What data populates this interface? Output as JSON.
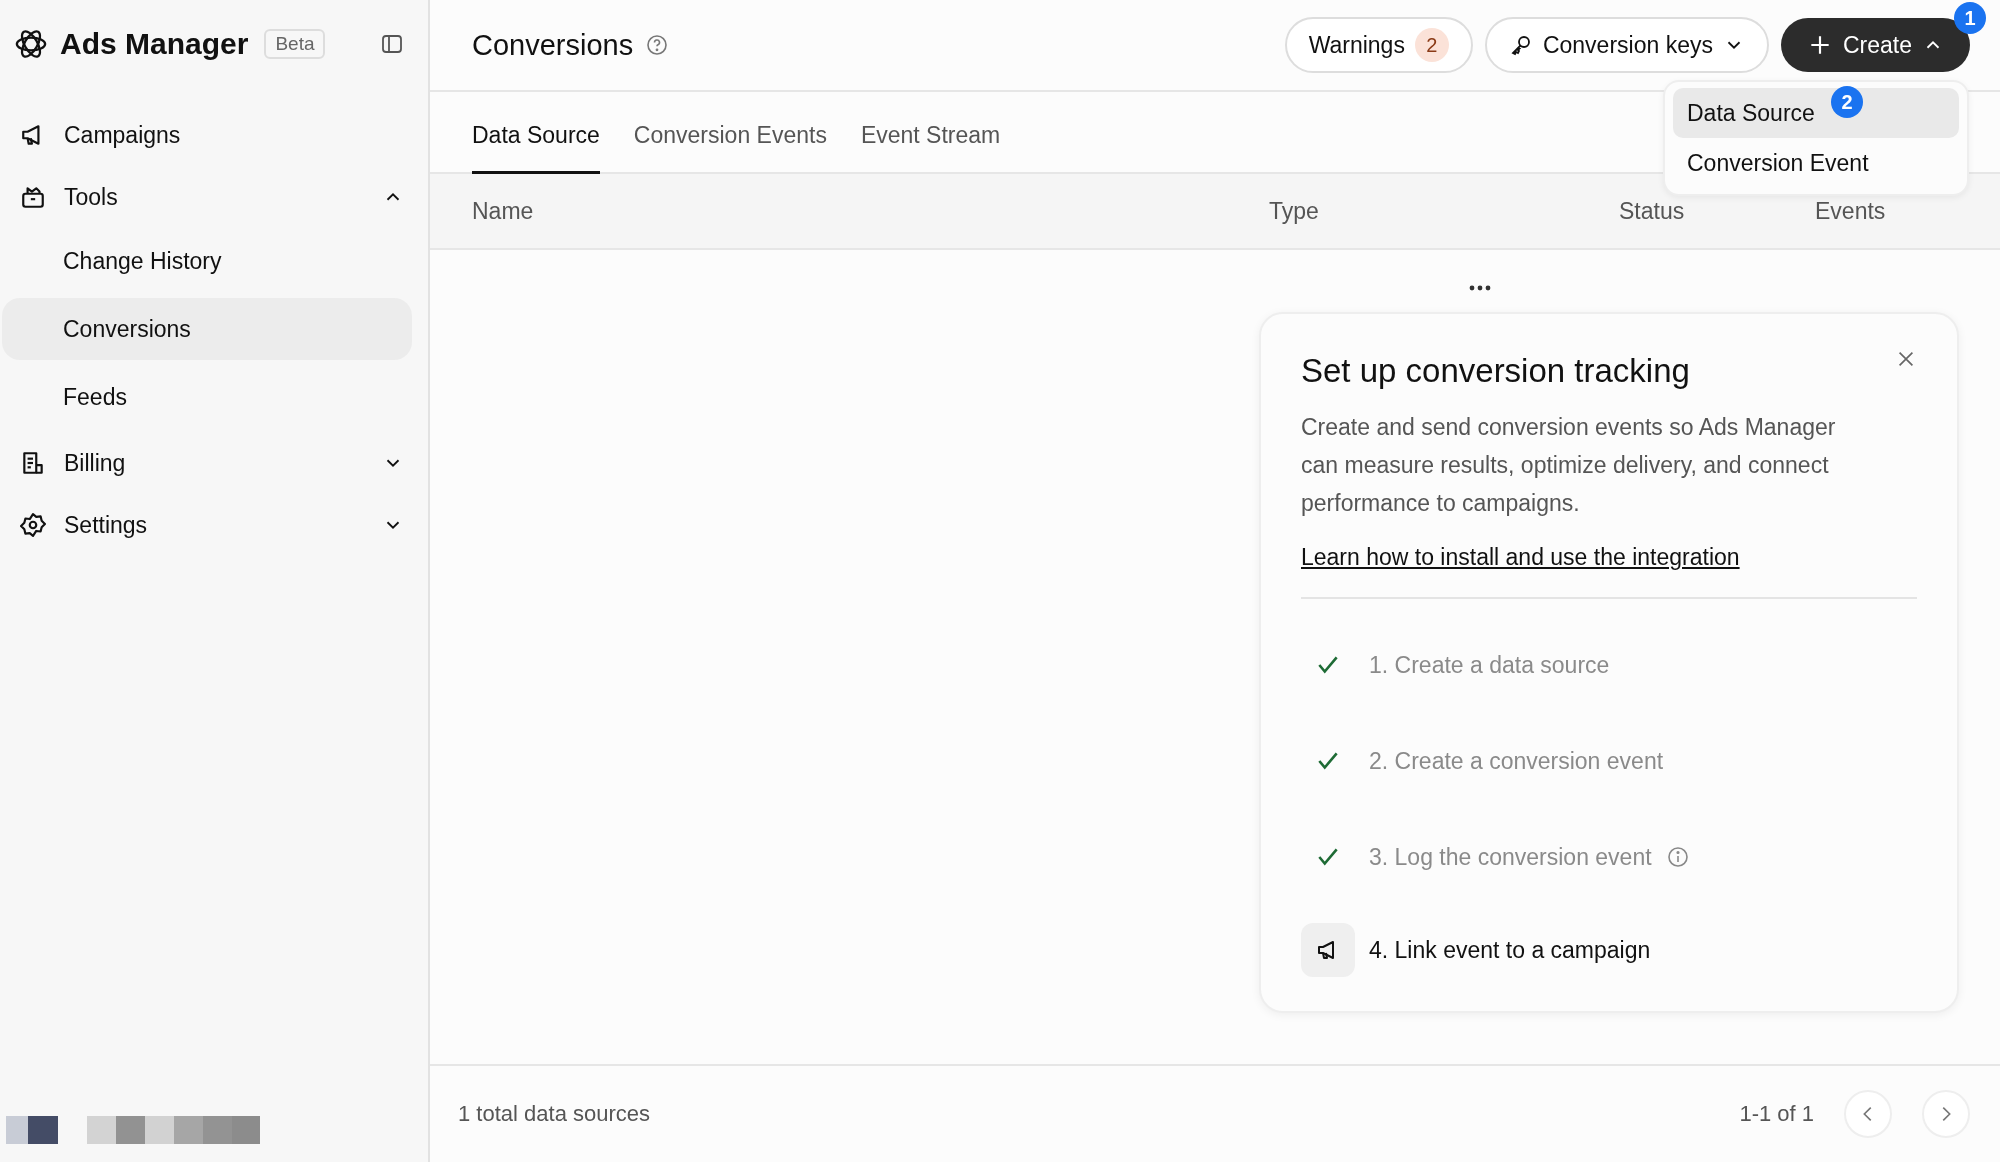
{
  "sidebar": {
    "app_title": "Ads Manager",
    "badge": "Beta",
    "items": [
      {
        "label": "Campaigns"
      },
      {
        "label": "Tools",
        "expanded": true,
        "children": [
          {
            "label": "Change History",
            "selected": false
          },
          {
            "label": "Conversions",
            "selected": true
          },
          {
            "label": "Feeds",
            "selected": false
          }
        ]
      },
      {
        "label": "Billing",
        "expanded": false
      },
      {
        "label": "Settings",
        "expanded": false
      }
    ]
  },
  "header": {
    "title": "Conversions",
    "warnings": {
      "label": "Warnings",
      "count": "2"
    },
    "keys_button": "Conversion keys",
    "create_button": "Create",
    "create_marker": "1"
  },
  "create_menu": {
    "items": [
      {
        "label": "Data Source",
        "selected": true,
        "marker": "2"
      },
      {
        "label": "Conversion Event",
        "selected": false
      }
    ]
  },
  "tabs": [
    {
      "label": "Data Source",
      "selected": true
    },
    {
      "label": "Conversion Events",
      "selected": false
    },
    {
      "label": "Event Stream",
      "selected": false
    }
  ],
  "table": {
    "columns": [
      "Name",
      "Type",
      "Status",
      "Events"
    ]
  },
  "setup_card": {
    "title": "Set up conversion tracking",
    "description": "Create and send conversion events so Ads Manager can measure results, optimize delivery, and connect performance to campaigns.",
    "link": "Learn how to install and use the integration",
    "steps": [
      {
        "label": "1. Create a data source",
        "kind": "done"
      },
      {
        "label": "2. Create a conversion event",
        "kind": "done"
      },
      {
        "label": "3. Log the conversion event",
        "kind": "done",
        "info": true
      },
      {
        "label": "4. Link event to a campaign",
        "kind": "current"
      }
    ]
  },
  "footer": {
    "total": "1 total data sources",
    "range": "1-1 of 1"
  }
}
